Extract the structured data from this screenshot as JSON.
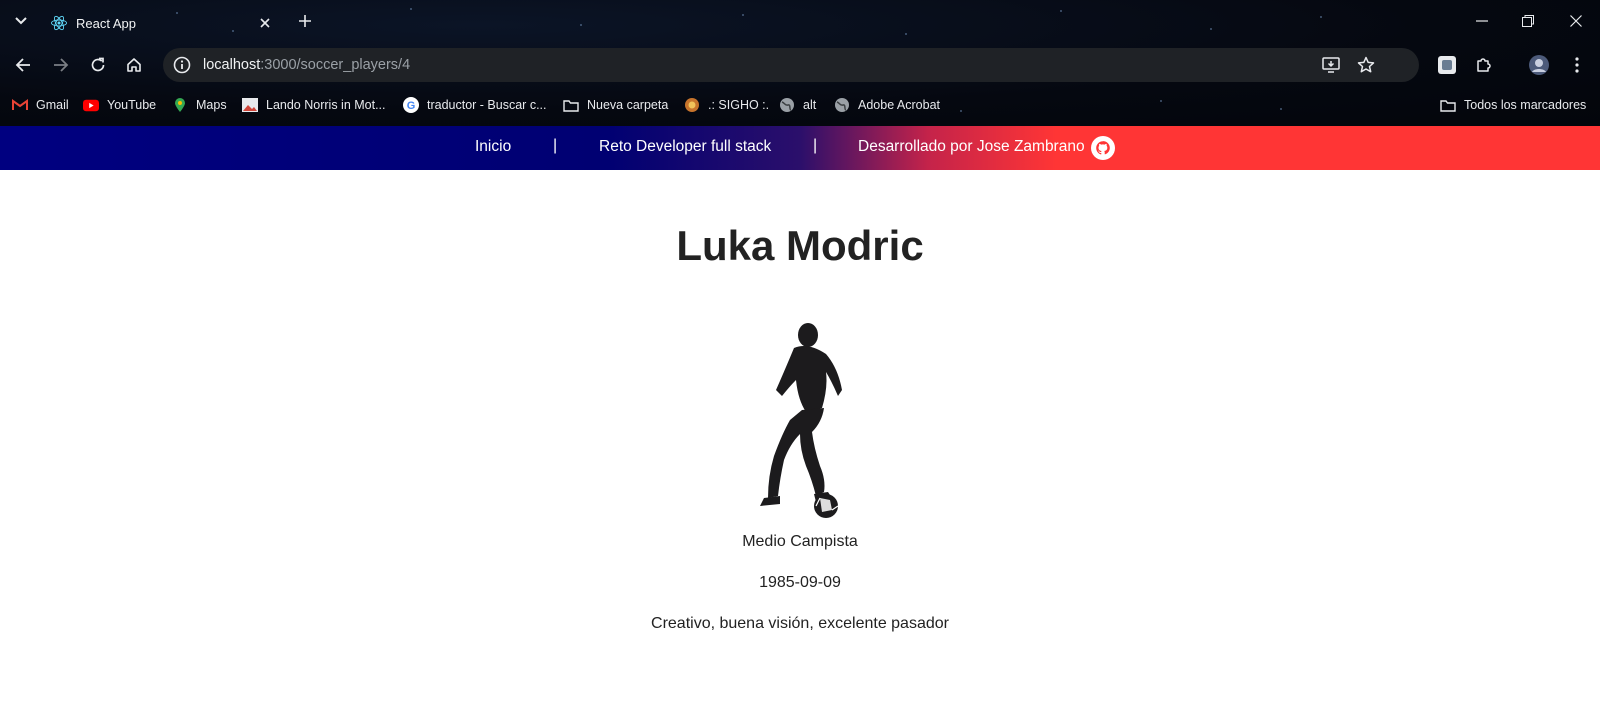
{
  "browser": {
    "tab_title": "React App",
    "url_host": "localhost",
    "url_path": ":3000/soccer_players/4",
    "bookmarks": [
      {
        "label": "Gmail",
        "icon": "gmail-icon"
      },
      {
        "label": "YouTube",
        "icon": "youtube-icon"
      },
      {
        "label": "Maps",
        "icon": "maps-icon"
      },
      {
        "label": "Lando Norris in Mot...",
        "icon": "image-icon"
      },
      {
        "label": "traductor - Buscar c...",
        "icon": "google-icon"
      },
      {
        "label": "Nueva carpeta",
        "icon": "folder-icon"
      },
      {
        "label": ".: SIGHO :.",
        "icon": "sigho-icon"
      },
      {
        "label": "alt",
        "icon": "globe-icon"
      },
      {
        "label": "Adobe Acrobat",
        "icon": "globe-icon"
      }
    ],
    "all_bookmarks": "Todos los marcadores"
  },
  "navbar": {
    "home": "Inicio",
    "separator": "|",
    "challenge": "Reto Developer full stack",
    "author": "Desarrollado por Jose Zambrano",
    "colors": {
      "left": "#000080",
      "right": "#ff3535"
    }
  },
  "player": {
    "name": "Luka Modric",
    "position": "Medio Campista",
    "birth_date": "1985-09-09",
    "description": "Creativo, buena visión, excelente pasador"
  }
}
